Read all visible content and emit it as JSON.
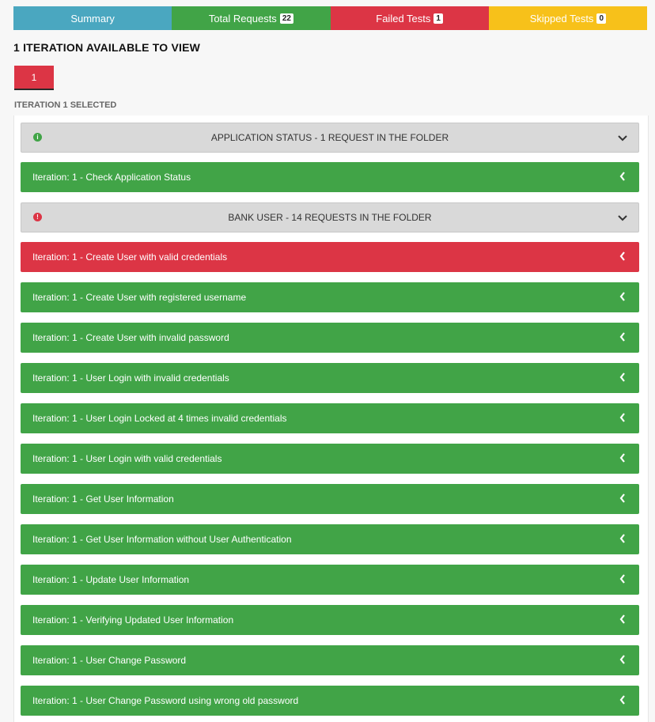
{
  "tabs": [
    {
      "label": "Summary",
      "badge": null,
      "color": "#4aa7c0"
    },
    {
      "label": "Total Requests",
      "badge": "22",
      "color": "#41a447"
    },
    {
      "label": "Failed Tests",
      "badge": "1",
      "color": "#dc3545"
    },
    {
      "label": "Skipped Tests",
      "badge": "0",
      "color": "#f7c11a"
    }
  ],
  "heading": "1 ITERATION AVAILABLE TO VIEW",
  "iteration_button": "1",
  "selected_label": "ITERATION 1 SELECTED",
  "folders": [
    {
      "title": "APPLICATION STATUS - 1 REQUEST IN THE FOLDER",
      "status": "pass",
      "icon": "info-icon",
      "color": "#41a447"
    },
    {
      "title": "BANK USER - 14 REQUESTS IN THE FOLDER",
      "status": "fail",
      "icon": "error-icon",
      "color": "#dc3545"
    }
  ],
  "requests": [
    {
      "label": "Iteration: 1 - Check Application Status",
      "status": "pass"
    },
    {
      "label": "Iteration: 1 - Create User with valid credentials",
      "status": "fail"
    },
    {
      "label": "Iteration: 1 - Create User with registered username",
      "status": "pass"
    },
    {
      "label": "Iteration: 1 - Create User with invalid password",
      "status": "pass"
    },
    {
      "label": "Iteration: 1 - User Login with invalid credentials",
      "status": "pass"
    },
    {
      "label": "Iteration: 1 - User Login Locked at 4 times invalid credentials",
      "status": "pass"
    },
    {
      "label": "Iteration: 1 - User Login with valid credentials",
      "status": "pass"
    },
    {
      "label": "Iteration: 1 - Get User Information",
      "status": "pass"
    },
    {
      "label": "Iteration: 1 - Get User Information without User Authentication",
      "status": "pass"
    },
    {
      "label": "Iteration: 1 - Update User Information",
      "status": "pass"
    },
    {
      "label": "Iteration: 1 - Verifying Updated User Information",
      "status": "pass"
    },
    {
      "label": "Iteration: 1 - User Change Password",
      "status": "pass"
    },
    {
      "label": "Iteration: 1 - User Change Password using wrong old password",
      "status": "pass"
    }
  ]
}
